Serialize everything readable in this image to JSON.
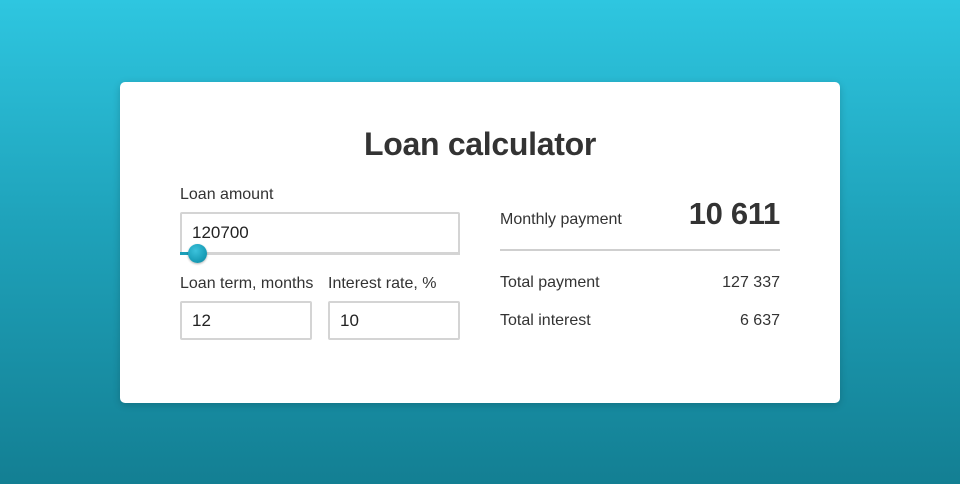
{
  "calculator": {
    "title": "Loan calculator",
    "loan_amount": {
      "label": "Loan amount",
      "value": "120700",
      "slider_fraction": 0.06
    },
    "loan_term": {
      "label": "Loan term, months",
      "value": "12"
    },
    "interest_rate": {
      "label": "Interest rate, %",
      "value": "10"
    }
  },
  "results": {
    "monthly_payment": {
      "label": "Monthly payment",
      "value": "10 611"
    },
    "total_payment": {
      "label": "Total payment",
      "value": "127 337"
    },
    "total_interest": {
      "label": "Total interest",
      "value": "6 637"
    }
  },
  "colors": {
    "accent": "#1a9fb9",
    "background_top": "#2ec6e0",
    "background_bottom": "#137f93",
    "card": "#ffffff",
    "text": "#333333",
    "border": "#d4d4d4"
  },
  "icons": {
    "slider_thumb": "slider-thumb-circle"
  }
}
